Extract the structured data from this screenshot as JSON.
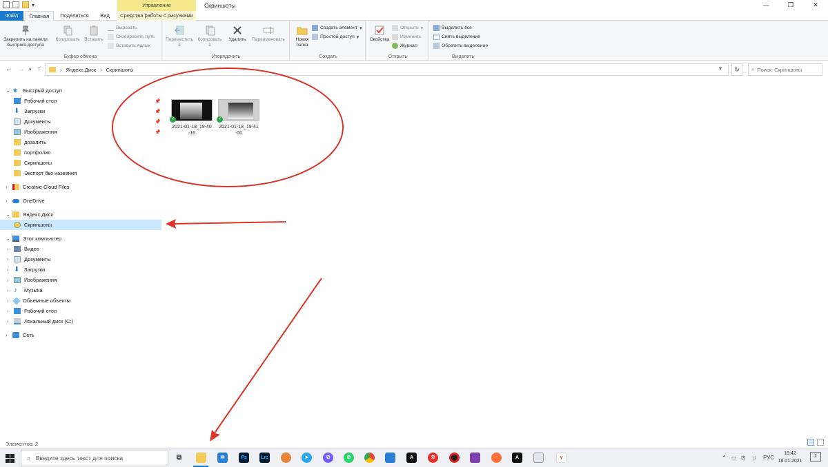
{
  "titlebar": {
    "context_group": "Управление",
    "window_title": "Скриншоты",
    "minimize": "—",
    "maximize": "❐",
    "close": "✕"
  },
  "tabs": {
    "file": "Файл",
    "home": "Главная",
    "share": "Поделиться",
    "view": "Вид",
    "picture_tools": "Средства работы с рисунками"
  },
  "ribbon": {
    "clipboard": {
      "label": "Буфер обмена",
      "pin": "Закрепить на панели быстрого доступа",
      "copy": "Копировать",
      "paste": "Вставить",
      "cut": "Вырезать",
      "copy_path": "Скопировать путь",
      "paste_shortcut": "Вставить ярлык"
    },
    "organize": {
      "label": "Упорядочить",
      "move": "Переместить в",
      "copy_to": "Копировать в",
      "delete": "Удалить",
      "rename": "Переименовать"
    },
    "create": {
      "label": "Создать",
      "new_folder": "Новая папка",
      "new_item": "Создать элемент",
      "easy_access": "Простой доступ"
    },
    "open": {
      "label": "Открыть",
      "properties": "Свойства",
      "open": "Открыть",
      "edit": "Изменить",
      "history": "Журнал"
    },
    "select": {
      "label": "Выделить",
      "select_all": "Выделить все",
      "select_none": "Снять выделение",
      "invert": "Обратить выделение"
    }
  },
  "address": {
    "back": "←",
    "forward": "→",
    "up": "↑",
    "path": [
      "Яндекс.Диск",
      "Скриншоты"
    ],
    "separator": "›",
    "search_placeholder": "Поиск: Скриншоты"
  },
  "nav": {
    "quick_access": "Быстрый доступ",
    "quick_items": [
      "Рабочий стол",
      "Загрузки",
      "Документы",
      "Изображения",
      "дозалить",
      "портфолио",
      "Скриншоты",
      "Экспорт без названия"
    ],
    "creative_cloud": "Creative Cloud Files",
    "onedrive": "OneDrive",
    "yandex": "Яндекс.Диск",
    "yandex_child": "Скриншоты",
    "this_pc": "Этот компьютер",
    "pc_items": [
      "Видео",
      "Документы",
      "Загрузки",
      "Изображения",
      "Музыка",
      "Объемные объекты",
      "Рабочий стол",
      "Локальный диск (C:)"
    ],
    "network": "Сеть"
  },
  "files": [
    {
      "name_line1": "2021-01-18_19-40",
      "name_line2": "-16"
    },
    {
      "name_line1": "2021-01-18_19-41",
      "name_line2": "-00"
    }
  ],
  "status": "Элементов: 2",
  "taskbar": {
    "search_placeholder": "Введите здесь текст для поиска",
    "apps": [
      "Ps",
      "Lrc",
      "A",
      "Я",
      "A",
      "Y"
    ],
    "lang": "РУС",
    "time": "19:42",
    "date": "18.01.2021",
    "notifications_count": "2"
  },
  "colors": {
    "accent": "#1979ca",
    "annotation": "#d9362b",
    "selection": "#cce8ff",
    "folder": "#f3cb59"
  }
}
